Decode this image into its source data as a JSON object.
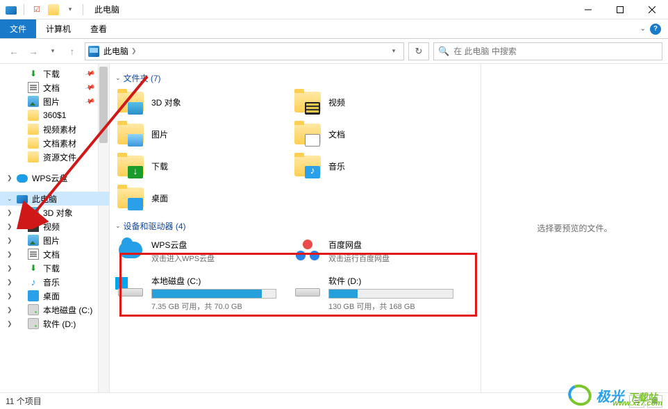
{
  "titlebar": {
    "title": "此电脑"
  },
  "ribbon": {
    "file": "文件",
    "computer": "计算机",
    "view": "查看"
  },
  "address": {
    "location_label": "此电脑",
    "search_placeholder": "在 此电脑 中搜索"
  },
  "sidebar": {
    "downloads": "下载",
    "documents": "文档",
    "pictures": "图片",
    "folder_360s1": "360$1",
    "video_assets": "视频素材",
    "doc_assets": "文档素材",
    "resource_files": "资源文件",
    "wps_cloud": "WPS云盘",
    "this_pc": "此电脑",
    "objects3d": "3D 对象",
    "video": "视频",
    "pictures2": "图片",
    "documents2": "文档",
    "downloads2": "下载",
    "music": "音乐",
    "desktop": "桌面",
    "local_disk_c": "本地磁盘 (C:)",
    "software_d": "软件 (D:)"
  },
  "groups": {
    "folders_header": "文件夹 (7)",
    "drives_header": "设备和驱动器 (4)"
  },
  "folders": {
    "objects3d": "3D 对象",
    "video": "视频",
    "pictures": "图片",
    "documents": "文档",
    "downloads": "下载",
    "music": "音乐",
    "desktop": "桌面"
  },
  "drives": {
    "wps": {
      "title": "WPS云盘",
      "sub": "双击进入WPS云盘"
    },
    "baidu": {
      "title": "百度网盘",
      "sub": "双击运行百度网盘"
    },
    "c": {
      "title": "本地磁盘 (C:)",
      "sub": "7.35 GB 可用，共 70.0 GB",
      "used_pct": 89
    },
    "d": {
      "title": "软件 (D:)",
      "sub": "130 GB 可用，共 168 GB",
      "used_pct": 23
    }
  },
  "preview": {
    "empty_text": "选择要预览的文件。"
  },
  "statusbar": {
    "text": "11 个项目"
  },
  "watermark": {
    "main": "极光",
    "sub": "下载站",
    "url": "www.xz7.com"
  }
}
